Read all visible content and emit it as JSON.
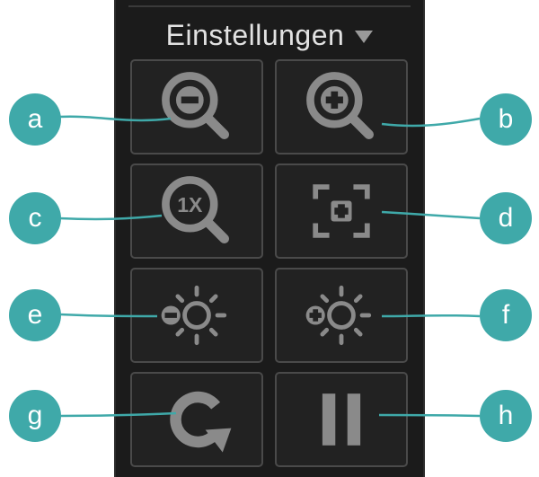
{
  "panel": {
    "title": "Einstellungen"
  },
  "buttons": [
    {
      "id": "a",
      "icon": "zoom-out-icon"
    },
    {
      "id": "b",
      "icon": "zoom-in-icon"
    },
    {
      "id": "c",
      "icon": "zoom-1x-icon"
    },
    {
      "id": "d",
      "icon": "fit-to-frame-icon"
    },
    {
      "id": "e",
      "icon": "brightness-down-icon"
    },
    {
      "id": "f",
      "icon": "brightness-up-icon"
    },
    {
      "id": "g",
      "icon": "rotate-icon"
    },
    {
      "id": "h",
      "icon": "pause-icon"
    }
  ],
  "callouts": {
    "a": "a",
    "b": "b",
    "c": "c",
    "d": "d",
    "e": "e",
    "f": "f",
    "g": "g",
    "h": "h"
  },
  "icon_text": {
    "zoom_1x": "1X"
  },
  "colors": {
    "panel_background": "#1b1b1b",
    "button_border": "#4a4a4a",
    "icon_gray": "#8a8a8a",
    "callout_teal": "#3fa9a9",
    "title_text": "#e2e2e2"
  }
}
